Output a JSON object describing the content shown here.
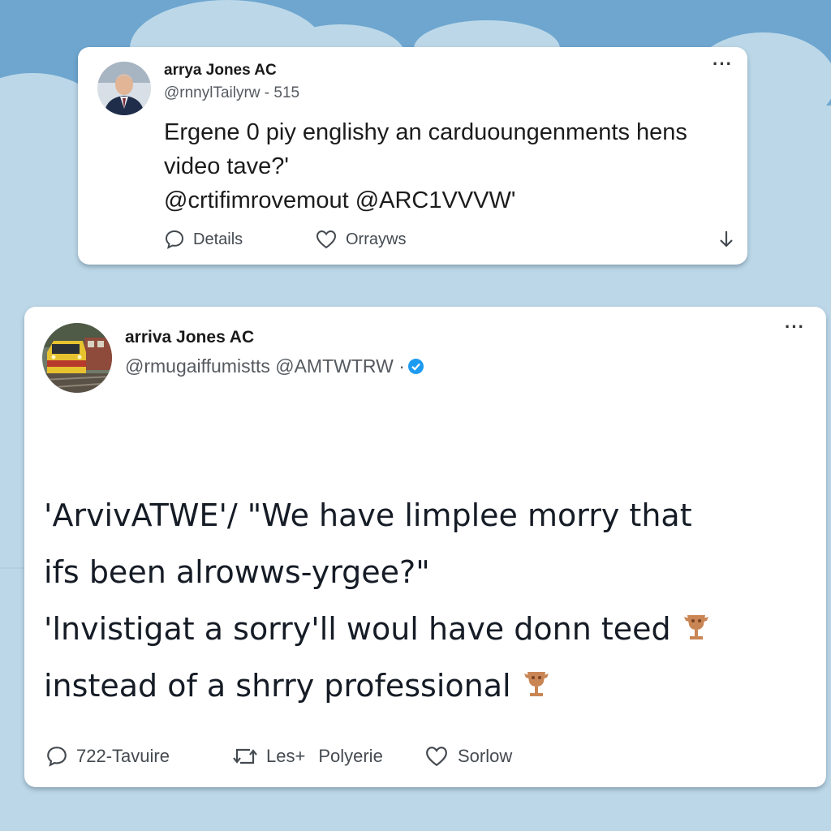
{
  "colors": {
    "sky": "#b9d6e6",
    "sky_band": "#6ea6cf",
    "card": "#ffffff",
    "verified": "#1d9bf0",
    "emoji": "#c98554"
  },
  "posts": [
    {
      "display_name": "arrya Jones AC",
      "handle": "@rnnylTailyrw - 515",
      "more_label": "···",
      "avatar_icon": "person-photo",
      "text_lines": [
        "Ergene 0 piy englishy an carduoungenments hens",
        "video tave?'",
        "@crtifimrovemout  @ARC1VVVW'"
      ],
      "actions": {
        "details": "Details",
        "like": "Orrayws",
        "share_icon": "share-down-icon"
      }
    },
    {
      "display_name": "arriva Jones AC",
      "handle": "@rmugaiffumistts  @AMTWTRW ·",
      "more_label": "···",
      "avatar_icon": "train-photo",
      "verified": true,
      "text_lines": [
        "'ArvivATWE'/ \"We have limplee morry that",
        "ifs been alrowws-yrgee?\"",
        "'lnvistigat a sorry'll woul have donn teed",
        "instead of a shrry professional"
      ],
      "emoji_icon": "trophy-emoji",
      "actions": {
        "reply": "722-Tavuire",
        "retweet_a": "Les+",
        "retweet_b": "Polyerie",
        "like": "Sorlow"
      }
    }
  ]
}
